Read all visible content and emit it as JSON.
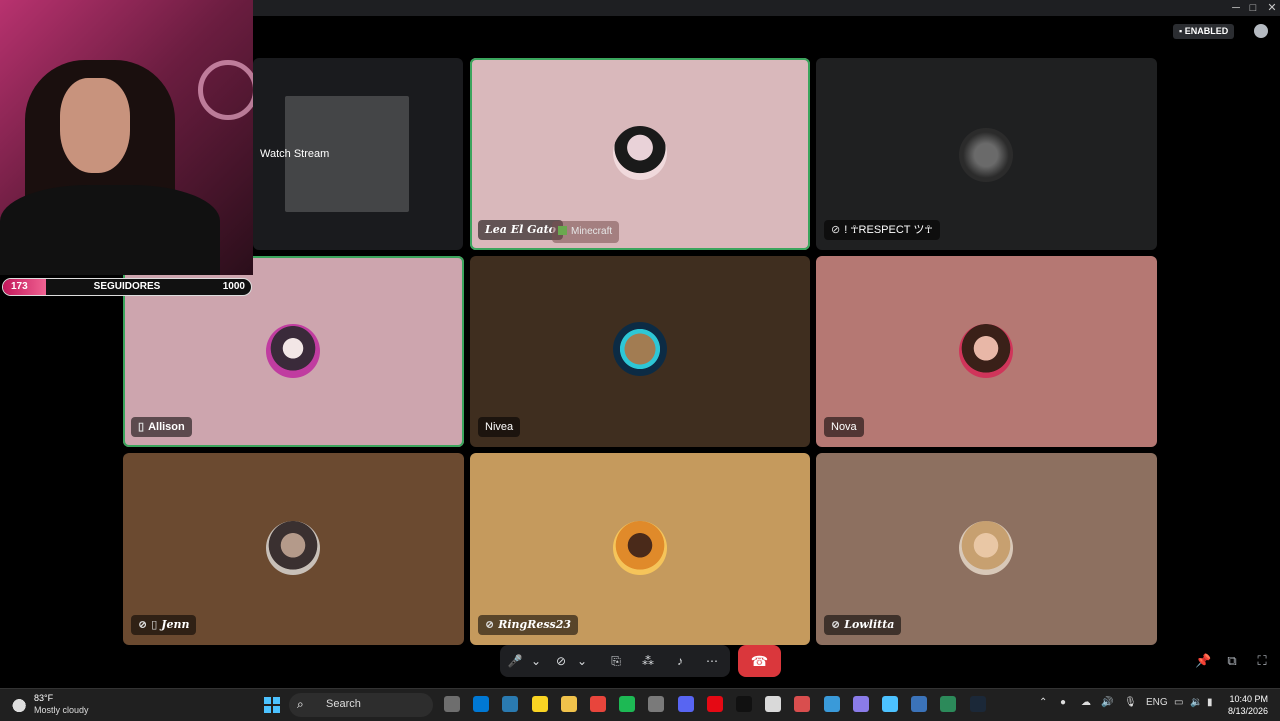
{
  "window": {
    "minimize": "─",
    "maximize": "□",
    "close": "✕"
  },
  "header": {
    "enabled_label": "ENABLED"
  },
  "stream_overlay": {
    "follower_current": "173",
    "follower_label": "SEGUIDORES",
    "follower_goal": "1000",
    "follower_progress": 0.173
  },
  "watch_stream": {
    "label": "Watch Stream"
  },
  "participants": [
    {
      "name": "Lea El Gato",
      "game": "Minecraft",
      "bg": "#d9b8bb",
      "speaking": true
    },
    {
      "name": "! ☥RESPECT ツ☥",
      "bg": "#1f2021",
      "muted": true
    },
    {
      "name": "Allison",
      "bg": "#cda5ae",
      "speaking": true,
      "mobile": true
    },
    {
      "name": "Nivea",
      "bg": "#3f2e1f"
    },
    {
      "name": "Nova",
      "bg": "#b57873"
    },
    {
      "name": "Jenn",
      "bg": "#6b4a30",
      "muted": true,
      "mobile": true
    },
    {
      "name": "RingRess23",
      "bg": "#c59a5d",
      "muted": true
    },
    {
      "name": "Lowlitta",
      "bg": "#8d7060",
      "muted": true
    }
  ],
  "controls": {
    "mic": "🎤",
    "mic_menu": "⌄",
    "camera_off": "⊘",
    "cam_menu": "⌄",
    "screen_share": "⎘",
    "activities": "⁂",
    "soundboard": "♪",
    "more": "⋯",
    "hangup": "☎",
    "pin": "📌",
    "popout": "⧉",
    "fullscreen": "⛶"
  },
  "taskbar": {
    "weather_temp": "83°F",
    "weather_desc": "Mostly cloudy",
    "search_placeholder": "Search",
    "lang": "ENG",
    "time": "10:40 PM",
    "date": "8/13/2026",
    "apps": [
      "file-explorer",
      "store",
      "settings",
      "notes",
      "folder",
      "chrome",
      "spotify",
      "discord-alt",
      "discord",
      "netflix",
      "tiktok",
      "photos",
      "calendar",
      "screen",
      "gamepad",
      "maps",
      "calculator",
      "terminal",
      "steam"
    ],
    "app_colors": [
      "#6e6e6e",
      "#0078d4",
      "#2a7ab0",
      "#f9d423",
      "#f0c24b",
      "#e8453c",
      "#1db954",
      "#7a7a7a",
      "#5865f2",
      "#e50914",
      "#111111",
      "#d9d9d9",
      "#d94e4e",
      "#3a9ad9",
      "#8a7be8",
      "#4cc2ff",
      "#3b73b9",
      "#2c8a5a",
      "#1b2838"
    ]
  }
}
